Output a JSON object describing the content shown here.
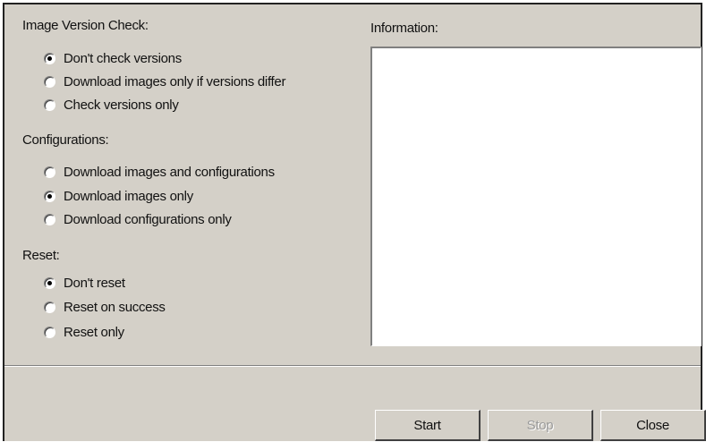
{
  "image_version_check": {
    "label": "Image Version Check:",
    "options": [
      {
        "label": "Don't check versions",
        "checked": true
      },
      {
        "label": "Download images only if versions differ",
        "checked": false
      },
      {
        "label": "Check versions only",
        "checked": false
      }
    ]
  },
  "configurations": {
    "label": "Configurations:",
    "options": [
      {
        "label": "Download images and configurations",
        "checked": false
      },
      {
        "label": "Download images only",
        "checked": true
      },
      {
        "label": "Download configurations only",
        "checked": false
      }
    ]
  },
  "reset": {
    "label": "Reset:",
    "options": [
      {
        "label": "Don't reset",
        "checked": true
      },
      {
        "label": "Reset on success",
        "checked": false
      },
      {
        "label": "Reset only",
        "checked": false
      }
    ]
  },
  "information": {
    "label": "Information:",
    "content": ""
  },
  "buttons": {
    "start": {
      "label": "Start",
      "enabled": true
    },
    "stop": {
      "label": "Stop",
      "enabled": false
    },
    "close": {
      "label": "Close",
      "enabled": true
    }
  },
  "colors": {
    "window_bg": "#d4d0c8",
    "text": "#111111",
    "disabled_text": "#9a9a9a"
  }
}
